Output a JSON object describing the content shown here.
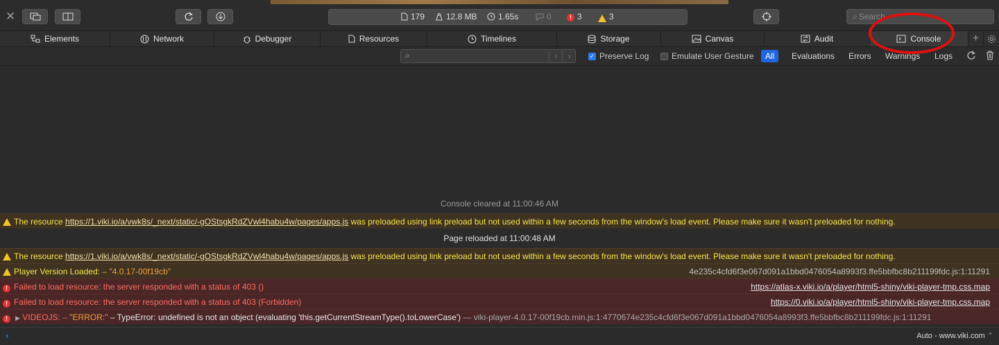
{
  "toolbar": {
    "activity": {
      "resources": "179",
      "size": "12.8 MB",
      "time": "1.65s",
      "logs": "0",
      "errors": "3",
      "warnings": "3"
    },
    "search_placeholder": "Search"
  },
  "tabs": [
    "Elements",
    "Network",
    "Debugger",
    "Resources",
    "Timelines",
    "Storage",
    "Canvas",
    "Audit",
    "Console"
  ],
  "filters": {
    "preserve_log": "Preserve Log",
    "emulate_gesture": "Emulate User Gesture",
    "buttons": [
      "All",
      "Evaluations",
      "Errors",
      "Warnings",
      "Logs"
    ]
  },
  "console": {
    "cleared": "Console cleared at 11:00:46 AM",
    "reloaded": "Page reloaded at 11:00:48 AM",
    "warn1": {
      "pre": "The resource ",
      "link": "https://1.viki.io/a/vwk8s/_next/static/-gOStsgkRdZVwl4habu4w/pages/apps.js",
      "post": " was preloaded using link preload but not used within a few seconds from the window's load event. Please make sure it wasn't preloaded for nothing."
    },
    "warn2": {
      "pre": "The resource ",
      "link": "https://1.viki.io/a/vwk8s/_next/static/-gOStsgkRdZVwl4habu4w/pages/apps.js",
      "post": " was preloaded using link preload but not used within a few seconds from the window's load event. Please make sure it wasn't preloaded for nothing."
    },
    "player": {
      "label": "Player Version Loaded:",
      "sep": " – ",
      "value": "\"4.0.17-00f19cb\"",
      "src": "4e235c4cfd6f3e067d091a1bbd0476054a8993f3.ffe5bbfbc8b211199fdc.js:1:11291"
    },
    "err1": {
      "text": "Failed to load resource: the server responded with a status of 403 ()",
      "src": "https://atlas-x.viki.io/a/player/html5-shiny/viki-player-tmp.css.map"
    },
    "err2": {
      "text": "Failed to load resource: the server responded with a status of 403 (Forbidden)",
      "src": "https://0.viki.io/a/player/html5-shiny/viki-player-tmp.css.map"
    },
    "err3": {
      "a": "VIDEOJS:",
      "b": " – ",
      "c": "\"ERROR:\"",
      "d": " – TypeError: undefined is not an object (evaluating 'this.getCurrentStreamType().toLowerCase')",
      "e": " — viki-player-4.0.17-00f19cb.min.js:1:4770674e235c4cfd6f3e067d091a1bbd0476054a8993f3.ffe5bbfbc8b211199fdc.js:1:11291"
    }
  },
  "prompt": {
    "context": "Auto - www.viki.com"
  },
  "colors": {
    "accent": "#2266e0",
    "warning": "#f8e54a",
    "error": "#ff6d60",
    "annotation": "#e01010"
  }
}
